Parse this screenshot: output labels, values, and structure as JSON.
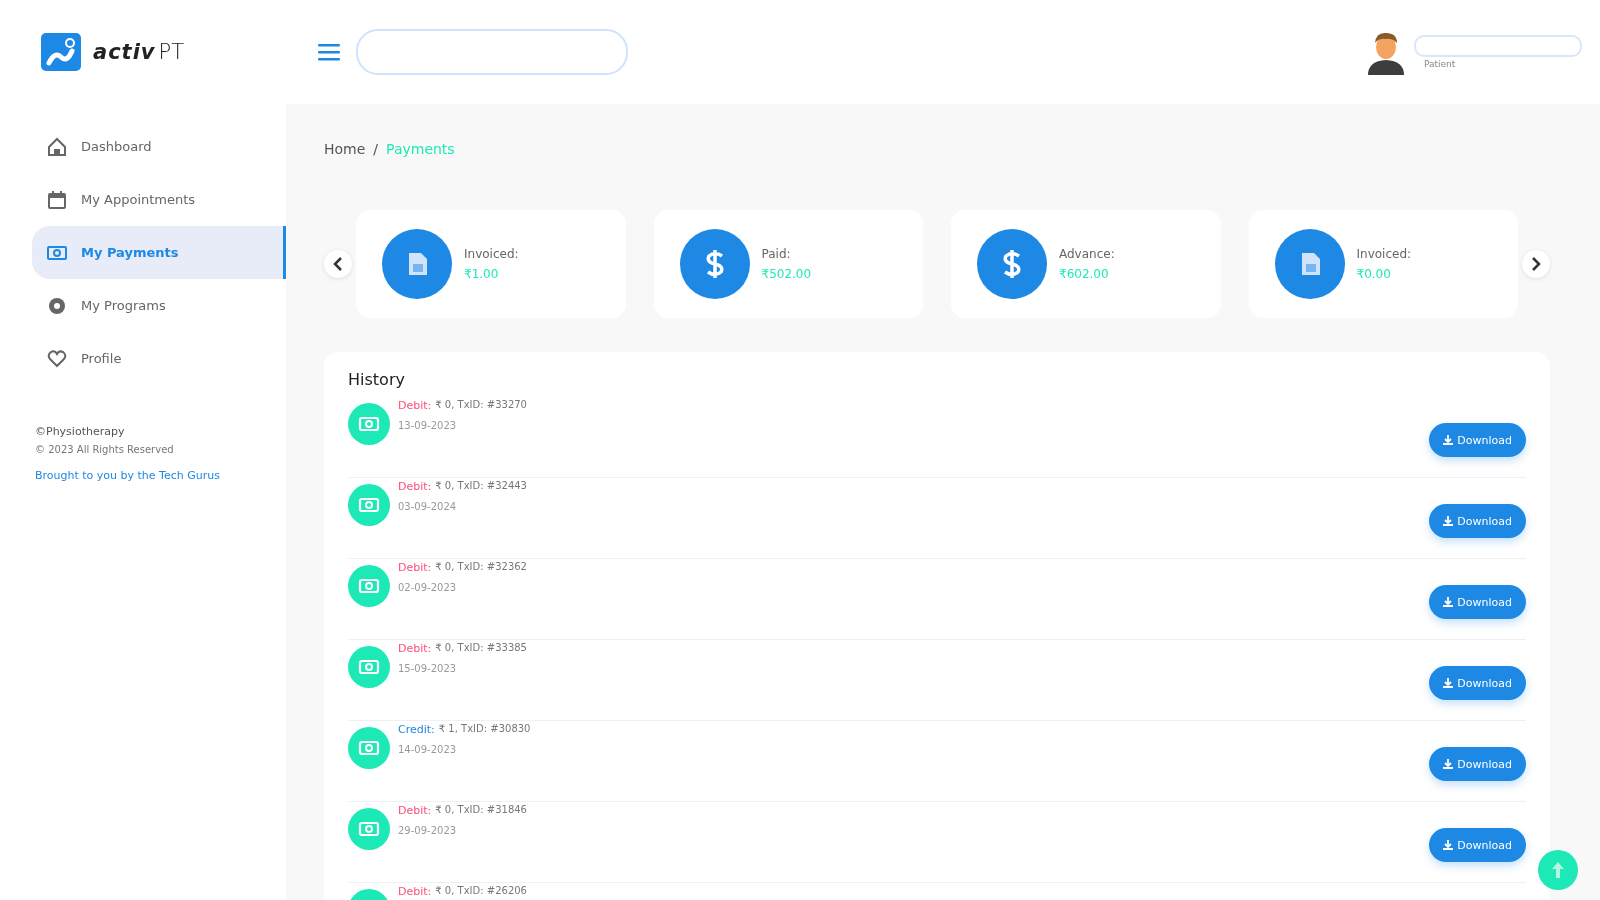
{
  "brand": {
    "name_bold": "activ",
    "name_light": "PT"
  },
  "sidebar": {
    "items": [
      {
        "label": "Dashboard",
        "kind": "home",
        "selected": false
      },
      {
        "label": "My Appointments",
        "kind": "calendar",
        "selected": false
      },
      {
        "label": "My Payments",
        "kind": "money",
        "selected": true
      },
      {
        "label": "My Programs",
        "kind": "disc",
        "selected": false
      },
      {
        "label": "Profile",
        "kind": "heart",
        "selected": false
      }
    ],
    "footer": {
      "company": "©Physiotherapy",
      "copyright": "© 2023 All Rights Reserved",
      "credit_link": "Brought to you by the Tech Gurus"
    }
  },
  "header": {
    "user_role": "Patient"
  },
  "breadcrumb": {
    "separator": "/",
    "items": [
      {
        "label": "Home",
        "selected": false
      },
      {
        "label": "Payments",
        "selected": true
      }
    ]
  },
  "summary_cards": [
    {
      "label": "Invoiced:",
      "amount": "₹1.00",
      "kind": "document"
    },
    {
      "label": "Paid:",
      "amount": "₹502.00",
      "kind": "dollar"
    },
    {
      "label": "Advance:",
      "amount": "₹602.00",
      "kind": "dollar"
    },
    {
      "label": "Invoiced:",
      "amount": "₹0.00",
      "kind": "document"
    }
  ],
  "history": {
    "title": "History",
    "rows": [
      {
        "kind": "debit",
        "type_label": "Debit:",
        "details": "₹ 0, TxID: #33270",
        "date": "13-09-2023",
        "button": "Download"
      },
      {
        "kind": "debit",
        "type_label": "Debit:",
        "details": "₹ 0, TxID: #32443",
        "date": "03-09-2024",
        "button": "Download"
      },
      {
        "kind": "debit",
        "type_label": "Debit:",
        "details": "₹ 0, TxID: #32362",
        "date": "02-09-2023",
        "button": "Download"
      },
      {
        "kind": "debit",
        "type_label": "Debit:",
        "details": "₹ 0, TxID: #33385",
        "date": "15-09-2023",
        "button": "Download"
      },
      {
        "kind": "credit",
        "type_label": "Credit:",
        "details": "₹ 1, TxID: #30830",
        "date": "14-09-2023",
        "button": "Download"
      },
      {
        "kind": "debit",
        "type_label": "Debit:",
        "details": "₹ 0, TxID: #31846",
        "date": "29-09-2023",
        "button": "Download"
      },
      {
        "kind": "debit",
        "type_label": "Debit:",
        "details": "₹ 0, TxID: #26206"
      }
    ]
  }
}
